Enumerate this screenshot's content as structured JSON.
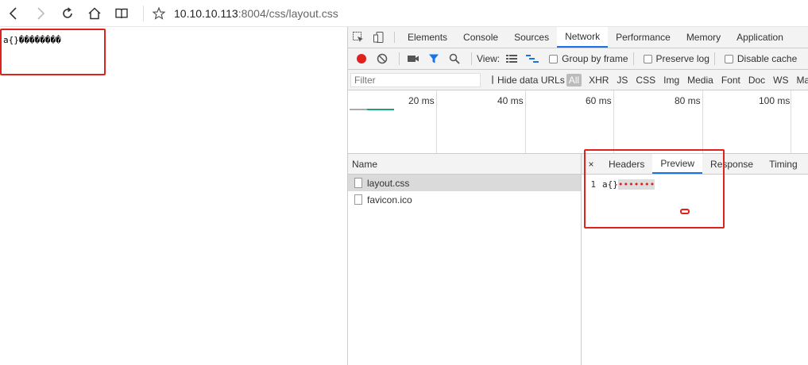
{
  "browser": {
    "url_host": "10.10.10.113",
    "url_path": ":8004/css/layout.css"
  },
  "page": {
    "content": "a{}��������"
  },
  "devtools": {
    "tabs": [
      "Elements",
      "Console",
      "Sources",
      "Network",
      "Performance",
      "Memory",
      "Application"
    ],
    "active_tab": "Network",
    "toolbar": {
      "view_label": "View:",
      "group_by_frame": "Group by frame",
      "preserve_log": "Preserve log",
      "disable_cache": "Disable cache"
    },
    "filter": {
      "placeholder": "Filter",
      "hide_data_urls": "Hide data URLs",
      "types": [
        "All",
        "XHR",
        "JS",
        "CSS",
        "Img",
        "Media",
        "Font",
        "Doc",
        "WS",
        "Ma"
      ]
    },
    "timeline": {
      "ticks": [
        "20 ms",
        "40 ms",
        "60 ms",
        "80 ms",
        "100 ms"
      ]
    },
    "requests": {
      "column_name": "Name",
      "files": [
        "layout.css",
        "favicon.ico"
      ],
      "selected": "layout.css"
    },
    "detail": {
      "close": "×",
      "tabs": [
        "Headers",
        "Preview",
        "Response",
        "Timing"
      ],
      "active_tab": "Preview",
      "line_number": "1",
      "code_prefix": "a{}",
      "code_garbled": "•••••••"
    }
  },
  "colors": {
    "highlight_box": "#e0221e",
    "active_tab_underline": "#1a73e8",
    "record_button": "#e0221e",
    "filter_icon": "#1a73e8"
  }
}
